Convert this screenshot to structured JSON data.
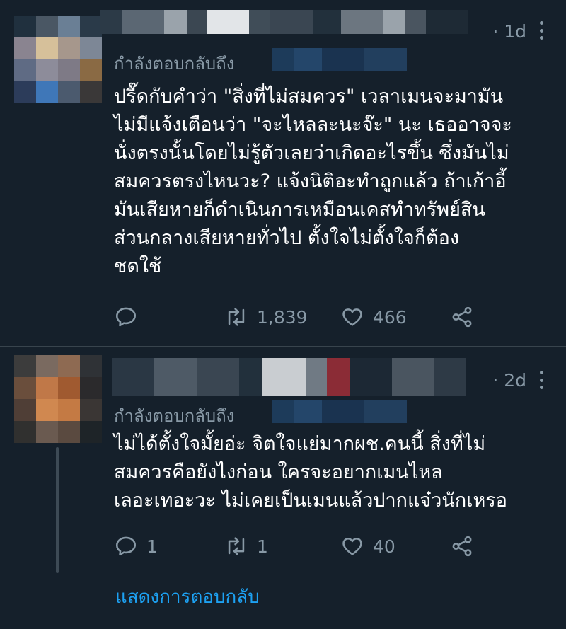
{
  "colors": {
    "background": "#15202b",
    "text": "#ffffff",
    "muted": "#8899a6",
    "link": "#1da1f2",
    "divider": "#38444d"
  },
  "tweets": [
    {
      "time": "· 1d",
      "replying_to": "กำลังตอบกลับถึง",
      "lines": [
        "ปรื๊ดกับคำว่า \"สิ่งที่ไม่สมควร\" เวลาเมนจะมามัน",
        "ไม่มีแจ้งเตือนว่า \"จะไหลละนะจ๊ะ\" นะ เธออาจจะ",
        "นั่งตรงนั้นโดยไม่รู้ตัวเลยว่าเกิดอะไรขึ้น ซึ่งมันไม่",
        "สมควรตรงไหนวะ? แจ้งนิติอะทำถูกแล้ว ถ้าเก้าอี้",
        "มันเสียหายก็ดำเนินการเหมือนเคสทำทรัพย์สิน",
        "ส่วนกลางเสียหายทั่วไป ตั้งใจไม่ตั้งใจก็ต้อง",
        "ชดใช้"
      ],
      "actions": {
        "reply": "",
        "retweet": "1,839",
        "like": "466"
      },
      "icons": [
        "reply-icon",
        "retweet-icon",
        "like-icon",
        "share-icon"
      ]
    },
    {
      "time": "· 2d",
      "replying_to": "กำลังตอบกลับถึง",
      "lines": [
        "ไม่ได้ตั้งใจมั้ยอ่ะ จิตใจแย่มากผช.คนนี้ สิ่งที่ไม่",
        "สมควรคือยังไงก่อน ใครจะอยากเมนไหล",
        "เลอะเทอะวะ ไม่เคยเป็นเมนแล้วปากแจ๋วนักเหรอ"
      ],
      "actions": {
        "reply": "1",
        "retweet": "1",
        "like": "40"
      },
      "icons": [
        "reply-icon",
        "retweet-icon",
        "like-icon",
        "share-icon"
      ]
    }
  ],
  "show_replies": "แสดงการตอบกลับ"
}
